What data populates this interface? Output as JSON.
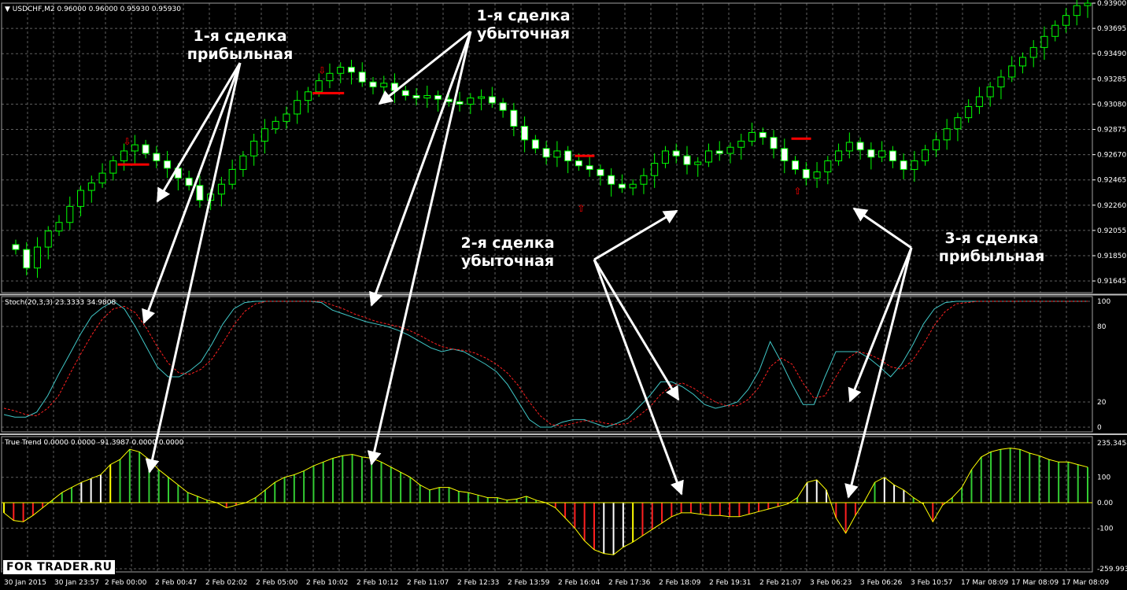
{
  "window": {
    "title": "USDCHF,M2",
    "ohlc": "0.96000 0.96000 0.95930 0.95930",
    "stoch_header": "Stoch(20,3,3) 23.3333 34.9808",
    "tt_header": "True Trend 0.0000 0.0000 -91.3987 0.0000 0.0000"
  },
  "annotations": [
    {
      "id": "trade1-profit",
      "lines": [
        "1-я сделка",
        "прибыльная"
      ]
    },
    {
      "id": "trade1-loss",
      "lines": [
        "1-я сделка",
        "убыточная"
      ]
    },
    {
      "id": "trade2-loss",
      "lines": [
        "2-я сделка",
        "убыточная"
      ]
    },
    {
      "id": "trade3-profit",
      "lines": [
        "3-я сделка",
        "прибыльная"
      ]
    }
  ],
  "logo": "FOR TRADER.RU",
  "colors": {
    "bull": "#00ff00",
    "bear_fill": "#ffffff",
    "grid": "#5f5f5f",
    "signal": "#ff0000",
    "stoch_main": "#40c8c8",
    "stoch_signal": "#ff2020",
    "tt_green": "#33cc33",
    "tt_red": "#ff2020",
    "tt_white": "#ffffff",
    "tt_yellow": "#ffff00"
  },
  "chart_data": [
    {
      "type": "candlestick",
      "title": "USDCHF,M2",
      "ylim": [
        0.9155,
        0.939
      ],
      "price_ticks": [
        "0.93900",
        "0.93695",
        "0.93490",
        "0.93285",
        "0.93080",
        "0.92875",
        "0.92670",
        "0.92465",
        "0.92260",
        "0.92055",
        "0.91850",
        "0.91645"
      ],
      "time_labels": [
        "30 Jan 2015",
        "30 Jan 23:57",
        "2 Feb 00:00",
        "2 Feb 00:47",
        "2 Feb 02:02",
        "2 Feb 05:00",
        "2 Feb 10:02",
        "2 Feb 10:12",
        "2 Feb 11:07",
        "2 Feb 12:33",
        "2 Feb 13:59",
        "2 Feb 16:04",
        "2 Feb 17:36",
        "2 Feb 18:09",
        "2 Feb 19:31",
        "2 Feb 21:07",
        "3 Feb 06:23",
        "3 Feb 06:26",
        "3 Feb 10:57",
        "17 Mar 08:09",
        "17 Mar 08:09",
        "17 Mar 08:09"
      ],
      "closes": [
        0.919,
        0.9175,
        0.9192,
        0.9205,
        0.9212,
        0.9225,
        0.9238,
        0.9244,
        0.9252,
        0.9262,
        0.927,
        0.9275,
        0.9268,
        0.9262,
        0.9256,
        0.9248,
        0.9242,
        0.923,
        0.9235,
        0.9243,
        0.9255,
        0.9266,
        0.9278,
        0.9288,
        0.9294,
        0.93,
        0.9311,
        0.9318,
        0.9327,
        0.9333,
        0.9338,
        0.9334,
        0.9326,
        0.9322,
        0.9325,
        0.9319,
        0.9315,
        0.9313,
        0.9315,
        0.9312,
        0.931,
        0.9308,
        0.9313,
        0.9314,
        0.9309,
        0.9303,
        0.929,
        0.9279,
        0.9272,
        0.9265,
        0.927,
        0.9262,
        0.9258,
        0.9255,
        0.925,
        0.9243,
        0.924,
        0.9243,
        0.925,
        0.926,
        0.927,
        0.9266,
        0.9259,
        0.9261,
        0.927,
        0.9268,
        0.9273,
        0.9278,
        0.9285,
        0.9281,
        0.9272,
        0.9262,
        0.9255,
        0.9248,
        0.9253,
        0.9262,
        0.927,
        0.9277,
        0.9271,
        0.9265,
        0.927,
        0.9262,
        0.9255,
        0.9262,
        0.9271,
        0.9279,
        0.9288,
        0.9297,
        0.9306,
        0.9314,
        0.9322,
        0.933,
        0.9339,
        0.9346,
        0.9354,
        0.9363,
        0.9372,
        0.938,
        0.9388,
        0.939
      ],
      "sell_signals": [
        {
          "index": 10,
          "price": 0.9259
        },
        {
          "index": 28,
          "price": 0.9317
        }
      ],
      "buy_signals": [
        {
          "index": 52,
          "price": 0.9236
        },
        {
          "index": 72,
          "price": 0.925
        }
      ]
    },
    {
      "type": "line",
      "title": "Stoch(20,3,3)",
      "ylim": [
        0,
        100
      ],
      "y_ticks": [
        0,
        20,
        80,
        100
      ],
      "series": [
        {
          "name": "main",
          "values": [
            10,
            8,
            8,
            12,
            25,
            42,
            58,
            74,
            88,
            95,
            100,
            94,
            80,
            64,
            48,
            40,
            40,
            45,
            52,
            66,
            82,
            94,
            99,
            100,
            100,
            100,
            100,
            100,
            100,
            99,
            93,
            90,
            87,
            84,
            82,
            80,
            77,
            73,
            68,
            63,
            60,
            62,
            60,
            55,
            50,
            44,
            34,
            20,
            6,
            0,
            0,
            4,
            6,
            6,
            3,
            0,
            3,
            7,
            16,
            25,
            36,
            36,
            32,
            26,
            18,
            15,
            17,
            20,
            30,
            45,
            68,
            52,
            34,
            18,
            18,
            40,
            60,
            60,
            60,
            55,
            48,
            40,
            50,
            65,
            82,
            94,
            99,
            100,
            100,
            100,
            100,
            100,
            100,
            100,
            100,
            100,
            100,
            100,
            100,
            100
          ]
        },
        {
          "name": "signal",
          "values": [
            15,
            13,
            10,
            9,
            15,
            25,
            42,
            58,
            73,
            86,
            94,
            96,
            91,
            79,
            64,
            51,
            43,
            42,
            46,
            54,
            67,
            81,
            92,
            98,
            100,
            100,
            100,
            100,
            100,
            100,
            97,
            94,
            90,
            87,
            84,
            82,
            80,
            77,
            73,
            68,
            64,
            62,
            61,
            59,
            55,
            50,
            43,
            33,
            20,
            9,
            2,
            1,
            3,
            5,
            5,
            3,
            2,
            3,
            9,
            16,
            26,
            33,
            35,
            31,
            25,
            20,
            17,
            17,
            22,
            32,
            48,
            55,
            50,
            35,
            23,
            25,
            40,
            54,
            60,
            58,
            54,
            48,
            46,
            53,
            66,
            81,
            92,
            98,
            99,
            100,
            100,
            100,
            100,
            100,
            100,
            100,
            100,
            100,
            100,
            100
          ]
        }
      ]
    },
    {
      "type": "bar",
      "title": "True Trend",
      "ylim": [
        -259.9937,
        235.3454
      ],
      "y_ticks": [
        "235.3454",
        "100",
        "0.00",
        "-100",
        "-259.9937"
      ],
      "values": [
        -40,
        -70,
        -75,
        -50,
        -20,
        10,
        40,
        60,
        80,
        95,
        110,
        150,
        170,
        210,
        200,
        170,
        130,
        100,
        70,
        40,
        25,
        10,
        0,
        -20,
        -10,
        0,
        20,
        50,
        80,
        100,
        110,
        125,
        145,
        160,
        175,
        185,
        190,
        180,
        175,
        160,
        140,
        120,
        100,
        70,
        50,
        60,
        60,
        45,
        40,
        30,
        20,
        20,
        10,
        15,
        25,
        10,
        0,
        -20,
        -60,
        -100,
        -150,
        -185,
        -200,
        -205,
        -175,
        -155,
        -130,
        -105,
        -80,
        -55,
        -40,
        -40,
        -45,
        -50,
        -50,
        -55,
        -55,
        -45,
        -35,
        -25,
        -15,
        -5,
        20,
        80,
        90,
        50,
        -60,
        -120,
        -50,
        10,
        80,
        100,
        70,
        50,
        20,
        -5,
        -75,
        -10,
        20,
        60,
        130,
        180,
        200,
        210,
        215,
        210,
        195,
        185,
        170,
        160,
        160,
        150,
        140
      ]
    }
  ]
}
